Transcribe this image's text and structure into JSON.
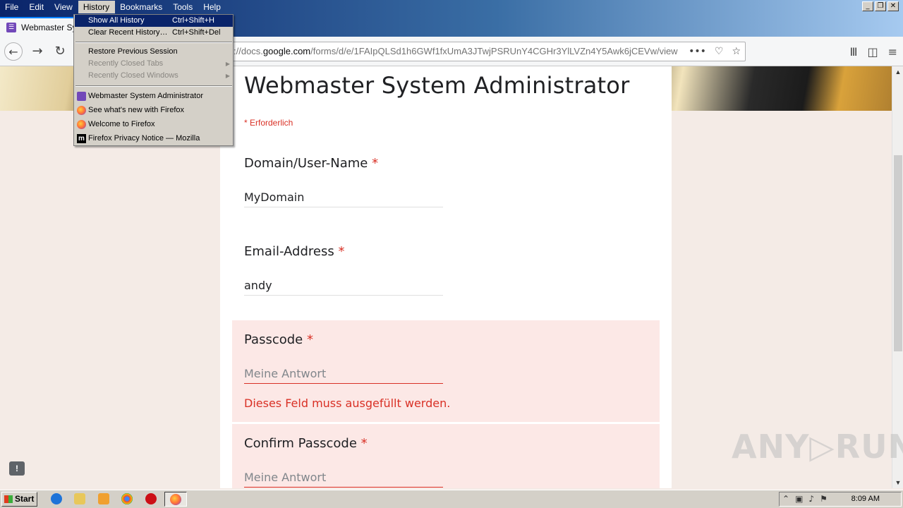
{
  "menubar": {
    "file": "File",
    "edit": "Edit",
    "view": "View",
    "history": "History",
    "bookmarks": "Bookmarks",
    "tools": "Tools",
    "help": "Help"
  },
  "tab": {
    "title": "Webmaster Sys"
  },
  "urlbar": {
    "prefix": "://docs.",
    "domain": "google.com",
    "rest": "/forms/d/e/1FAIpQLSd1h6GWf1fxUmA3JTwjPSRUnY4CGHr3YlLVZn4Y5Awk6jCEVw/view"
  },
  "history_menu": {
    "show_all": "Show All History",
    "show_all_shortcut": "Ctrl+Shift+H",
    "clear_recent": "Clear Recent History…",
    "clear_recent_shortcut": "Ctrl+Shift+Del",
    "restore_session": "Restore Previous Session",
    "recently_closed_tabs": "Recently Closed Tabs",
    "recently_closed_windows": "Recently Closed Windows",
    "entries": [
      "Webmaster System Administrator",
      "See what's new with Firefox",
      "Welcome to Firefox",
      "Firefox Privacy Notice — Mozilla"
    ]
  },
  "form": {
    "title": "Webmaster System Administrator",
    "required_note": "* Erforderlich",
    "required_star": "*",
    "fields": [
      {
        "label": "Domain/User-Name",
        "value": "MyDomain"
      },
      {
        "label": "Email-Address",
        "value": "andy"
      },
      {
        "label": "Passcode",
        "placeholder": "Meine Antwort",
        "error": "Dieses Feld muss ausgefüllt werden."
      },
      {
        "label": "Confirm Passcode",
        "placeholder": "Meine Antwort"
      }
    ]
  },
  "watermark": "ANY▷RUN",
  "taskbar": {
    "start": "Start",
    "clock": "8:09 AM"
  },
  "colors": {
    "accent_error": "#d93025",
    "menu_highlight": "#0a246a",
    "forms_purple": "#7248b9"
  }
}
